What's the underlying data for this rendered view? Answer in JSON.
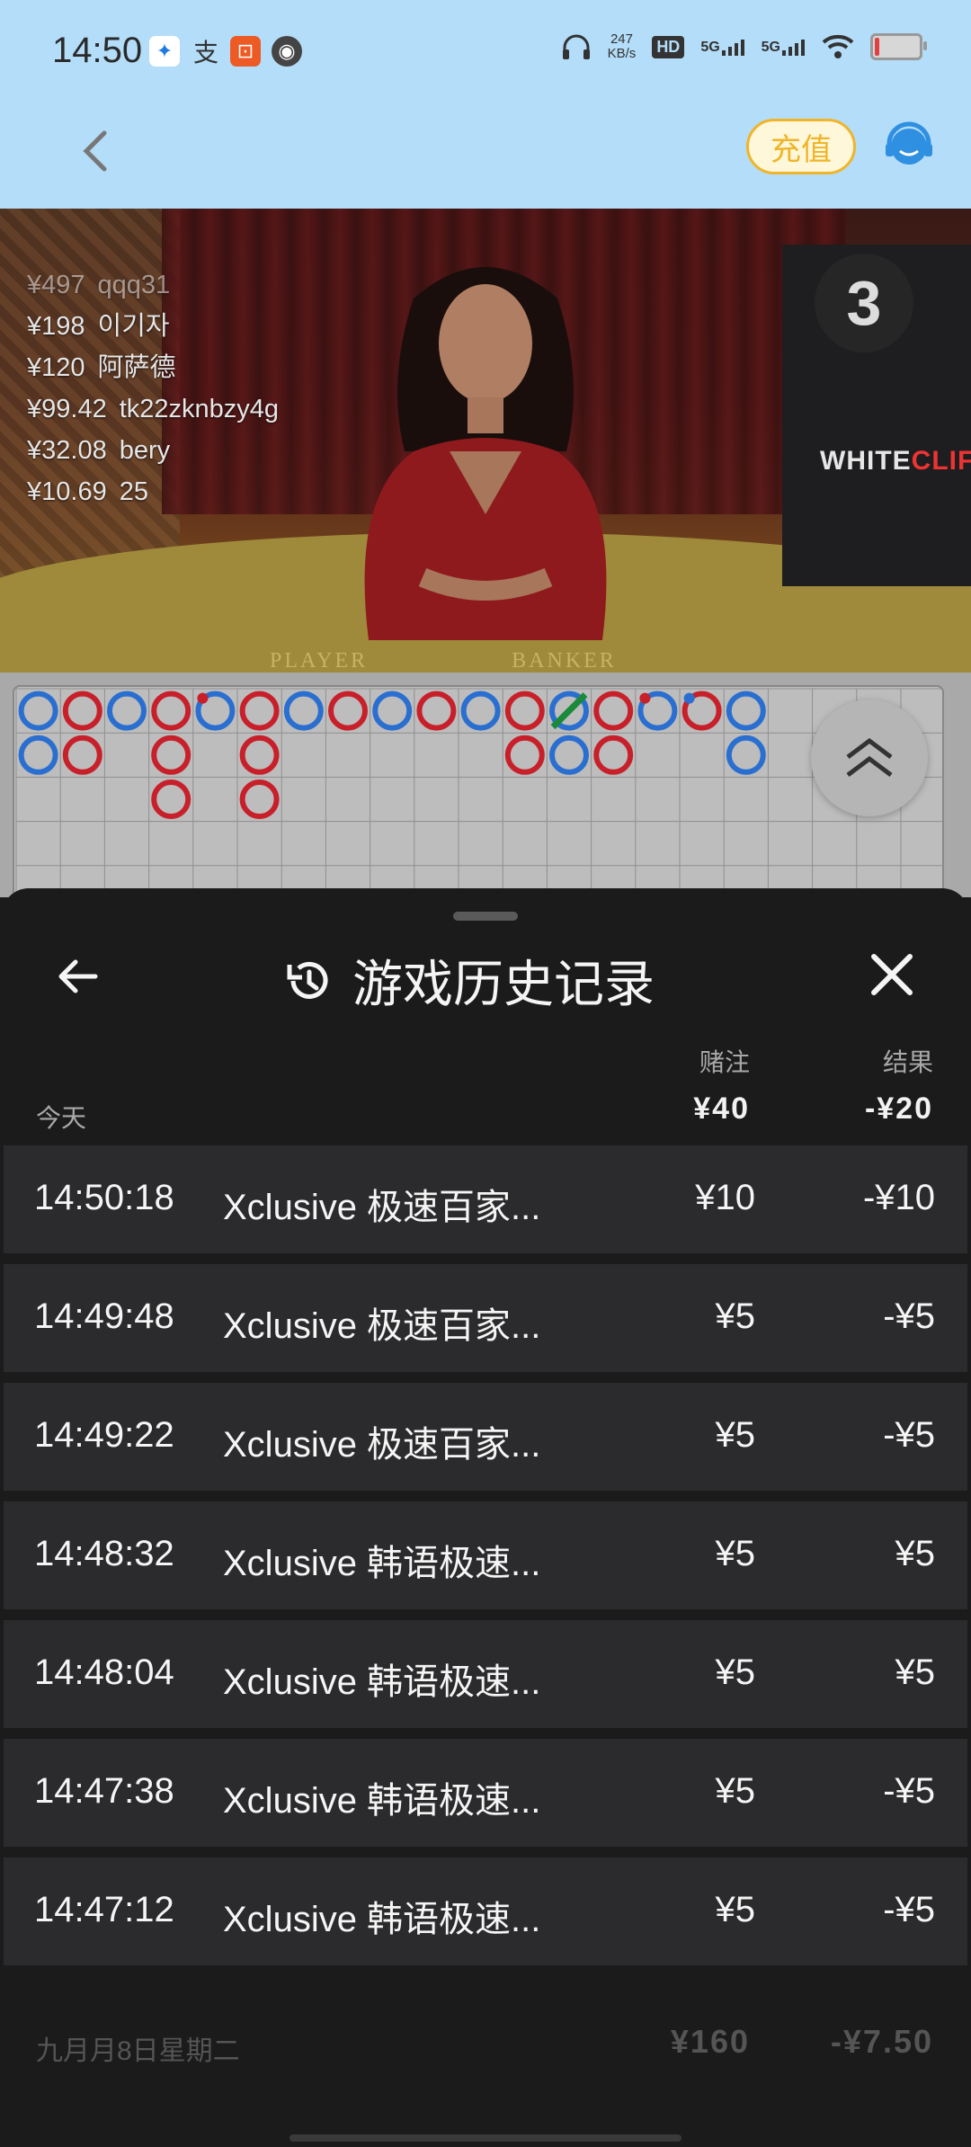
{
  "status_bar": {
    "time": "14:50",
    "net_speed": "247",
    "net_unit": "KB/s",
    "hd": "HD",
    "sig1": "5G",
    "sig2": "5G"
  },
  "app_bar": {
    "recharge_label": "充值"
  },
  "video": {
    "bets": [
      {
        "amount": "¥497",
        "name": "qqq31"
      },
      {
        "amount": "¥198",
        "name": "이기자"
      },
      {
        "amount": "¥120",
        "name": "阿萨德"
      },
      {
        "amount": "¥99.42",
        "name": "tk22zknbzy4g"
      },
      {
        "amount": "¥32.08",
        "name": "bery"
      },
      {
        "amount": "¥10.69",
        "name": "25"
      }
    ],
    "countdown": "3",
    "logo_main": "WHITE",
    "logo_accent": "CLIFF",
    "table_player": "PLAYER",
    "table_banker": "BANKER"
  },
  "roadmap": {
    "columns": [
      [
        "B",
        "B"
      ],
      [
        "R",
        "R"
      ],
      [
        "B"
      ],
      [
        "R",
        "R",
        "R"
      ],
      [
        "Bp"
      ],
      [
        "R",
        "R",
        "R"
      ],
      [
        "B"
      ],
      [
        "R"
      ],
      [
        "B"
      ],
      [
        "R"
      ],
      [
        "B"
      ],
      [
        "R",
        "R"
      ],
      [
        "Bt",
        "B"
      ],
      [
        "R",
        "R"
      ],
      [
        "Bp"
      ],
      [
        "Rp"
      ],
      [
        "B",
        "B"
      ]
    ],
    "colors": {
      "banker": "#c8202a",
      "player": "#2a6fd0",
      "tie": "#1a8a3a"
    }
  },
  "sheet": {
    "title": "游戏历史记录",
    "col_bet": "赌注",
    "col_result": "结果",
    "today_label": "今天",
    "today_bet": "¥40",
    "today_result": "-¥20",
    "rows": [
      {
        "time": "14:50:18",
        "game": "Xclusive 极速百家...",
        "bet": "¥10",
        "result": "-¥10"
      },
      {
        "time": "14:49:48",
        "game": "Xclusive 极速百家...",
        "bet": "¥5",
        "result": "-¥5"
      },
      {
        "time": "14:49:22",
        "game": "Xclusive 极速百家...",
        "bet": "¥5",
        "result": "-¥5"
      },
      {
        "time": "14:48:32",
        "game": "Xclusive 韩语极速...",
        "bet": "¥5",
        "result": "¥5"
      },
      {
        "time": "14:48:04",
        "game": "Xclusive 韩语极速...",
        "bet": "¥5",
        "result": "¥5"
      },
      {
        "time": "14:47:38",
        "game": "Xclusive 韩语极速...",
        "bet": "¥5",
        "result": "-¥5"
      },
      {
        "time": "14:47:12",
        "game": "Xclusive 韩语极速...",
        "bet": "¥5",
        "result": "-¥5"
      }
    ],
    "prev_date_label": "九月月8日星期二",
    "prev_bet": "¥160",
    "prev_result": "-¥7.50"
  }
}
